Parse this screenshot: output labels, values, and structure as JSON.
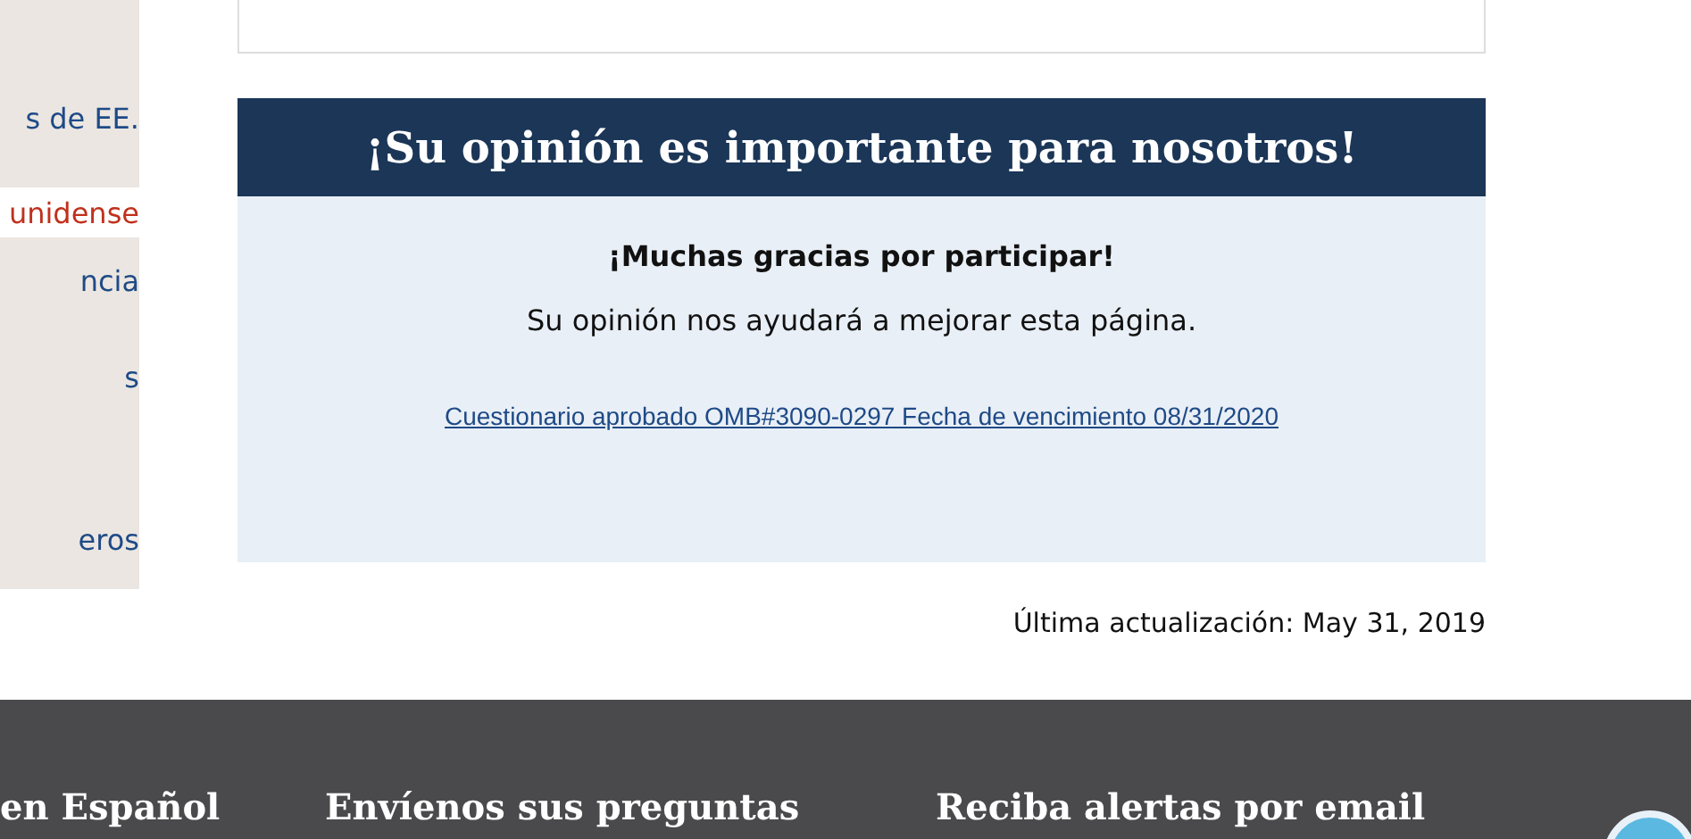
{
  "sidebar": {
    "items": [
      {
        "label": "s de EE.",
        "selected": false
      },
      {
        "label": "unidense",
        "selected": true
      },
      {
        "label": "ncia",
        "selected": false
      },
      {
        "label": "s",
        "selected": false
      },
      {
        "label": "eros",
        "selected": false
      }
    ]
  },
  "feedback": {
    "title": "¡Su opinión es importante para nosotros!",
    "thanks": "¡Muchas gracias por participar!",
    "message": "Su opinión nos ayudará a mejorar esta página.",
    "link": "Cuestionario aprobado OMB#3090-0297 Fecha de vencimiento 08/31/2020"
  },
  "last_updated": "Última actualización: May 31, 2019",
  "footer": {
    "headings": [
      "en Español",
      "Envíenos sus preguntas",
      "Reciba alertas por email"
    ]
  }
}
